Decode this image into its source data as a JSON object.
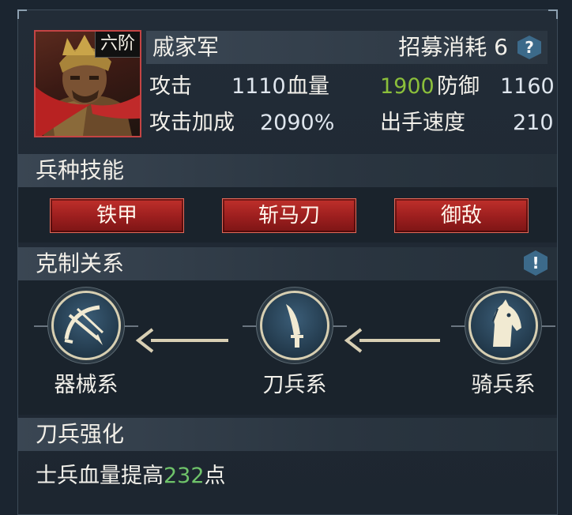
{
  "unit": {
    "rank": "六阶",
    "name": "戚家军",
    "recruit_cost_label": "招募消耗",
    "recruit_cost_value": "6",
    "help_icon": "?",
    "stats": {
      "attack_label": "攻击",
      "attack_value": "1110",
      "hp_label": "血量",
      "hp_value": "1900",
      "defense_label": "防御",
      "defense_value": "1160",
      "attack_bonus_label": "攻击加成",
      "attack_bonus_value": "2090%",
      "speed_label": "出手速度",
      "speed_value": "210"
    }
  },
  "skills": {
    "title": "兵种技能",
    "items": [
      "铁甲",
      "斩马刀",
      "御敌"
    ]
  },
  "counter": {
    "title": "克制关系",
    "info_icon": "!",
    "types": [
      {
        "label": "器械系",
        "icon": "crossbow-icon"
      },
      {
        "label": "刀兵系",
        "icon": "saber-icon"
      },
      {
        "label": "骑兵系",
        "icon": "horse-head-icon"
      }
    ]
  },
  "enhance": {
    "title": "刀兵强化",
    "text_before": "士兵血量提高",
    "value": "232",
    "text_after": "点"
  },
  "colors": {
    "accent_green": "#8bbf3b",
    "skill_red": "#9b1e1e",
    "badge_blue": "#3c6a8a"
  }
}
